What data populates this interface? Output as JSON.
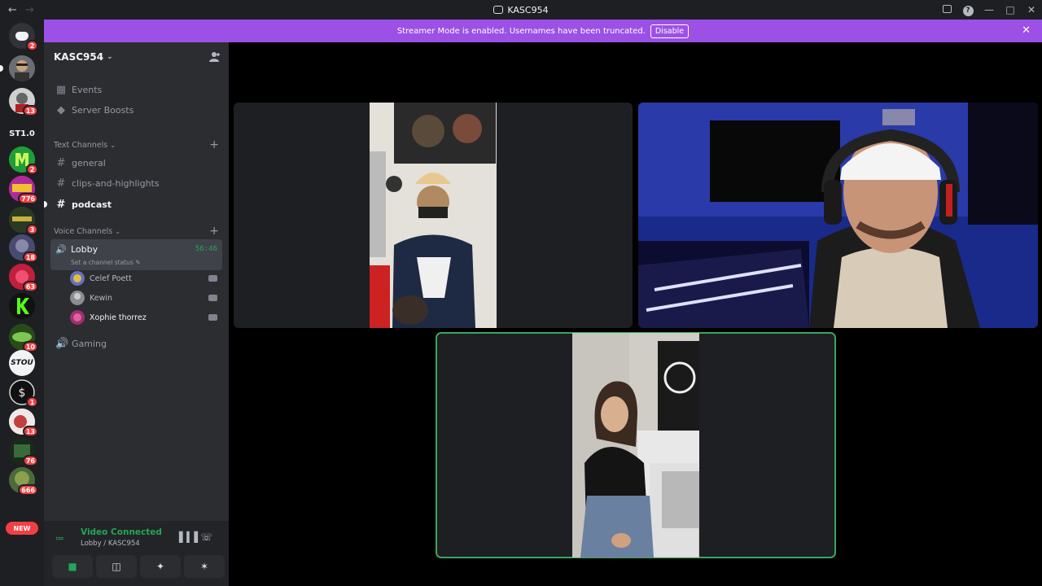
{
  "titlebar": {
    "title": "KASC954",
    "back": "←",
    "forward": "→"
  },
  "banner": {
    "message": "Streamer Mode is enabled. Usernames have been truncated.",
    "action": "Disable"
  },
  "guilds": [
    {
      "badge": "2"
    },
    {
      "badge": ""
    },
    {
      "badge": "13"
    },
    {
      "text": "ST1.0",
      "badge": ""
    },
    {
      "badge": "2"
    },
    {
      "badge": "776"
    },
    {
      "badge": "3"
    },
    {
      "badge": "18"
    },
    {
      "badge": "63"
    },
    {
      "badge": ""
    },
    {
      "badge": "10"
    },
    {
      "text": "STOU",
      "badge": ""
    },
    {
      "badge": "1"
    },
    {
      "badge": "13"
    },
    {
      "badge": "76"
    },
    {
      "badge": "666"
    }
  ],
  "new_label": "NEW",
  "server": {
    "name": "KASC954"
  },
  "sidebar": {
    "events": "Events",
    "boosts": "Server Boosts",
    "text_category": "Text Channels",
    "text_channels": [
      "general",
      "clips-and-highlights",
      "podcast"
    ],
    "voice_category": "Voice Channels",
    "lobby": {
      "name": "Lobby",
      "timer": "56:46",
      "status": "Set a channel status"
    },
    "members": [
      "Celef Poett",
      "Kewin",
      "Xophie thorrez"
    ],
    "gaming": "Gaming"
  },
  "voice_panel": {
    "title": "Video Connected",
    "subtitle": "Lobby / KASC954"
  },
  "colors": {
    "accent": "#9c50e6",
    "green": "#23a559",
    "red": "#f23f43"
  }
}
